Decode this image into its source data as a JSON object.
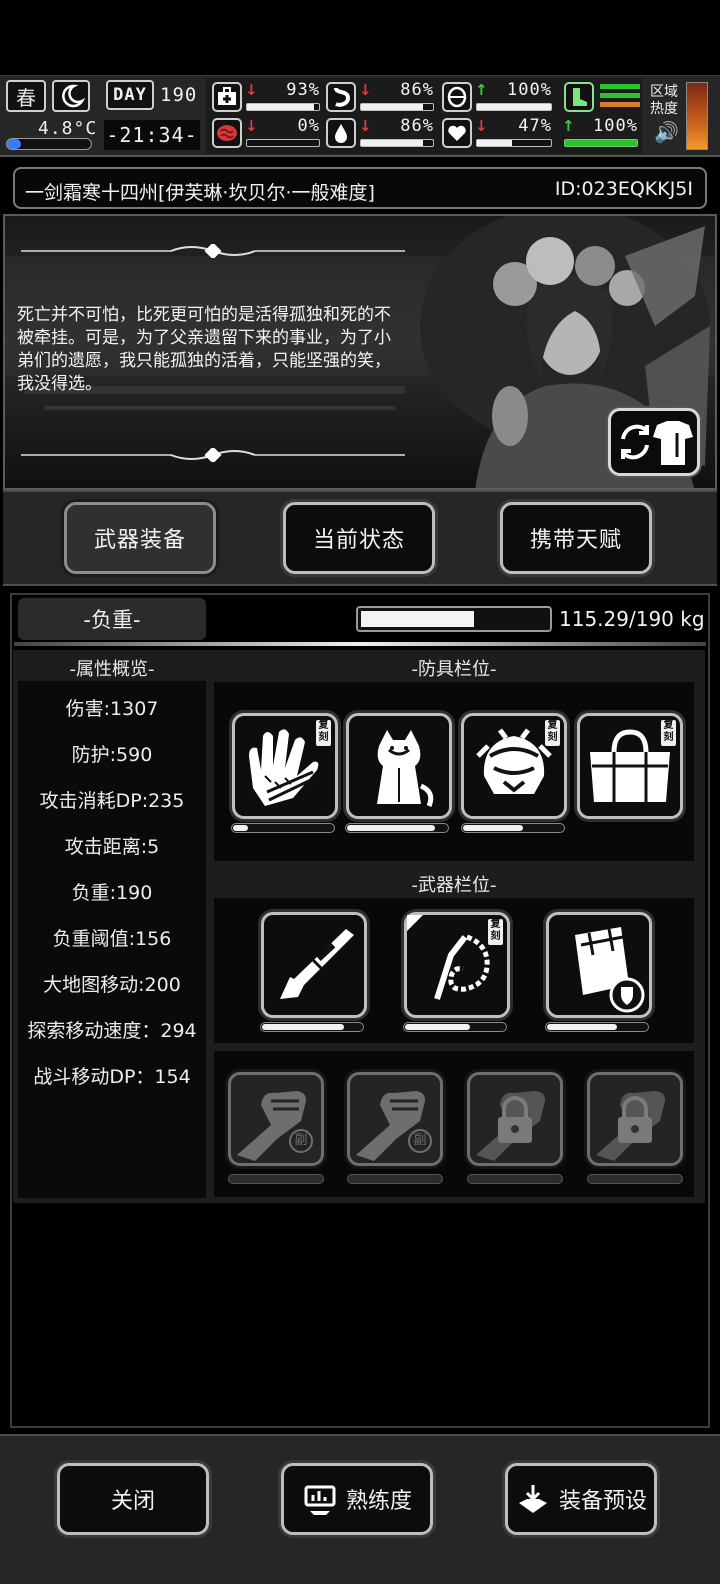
{
  "hud": {
    "season": "春",
    "temperature": "4.8°C",
    "day_label": "DAY",
    "day_value": "190",
    "clock": "-21:34-",
    "region_heat_label_1": "区域",
    "region_heat_label_2": "热度",
    "stats": [
      {
        "name": "health",
        "icon": "medkit-icon",
        "trend": "down",
        "value": "93%",
        "level": 0.93
      },
      {
        "name": "hunger",
        "icon": "stomach-icon",
        "trend": "down",
        "value": "86%",
        "level": 0.86
      },
      {
        "name": "stamina",
        "icon": "capsule-icon",
        "trend": "up",
        "value": "100%",
        "level": 1.0
      },
      {
        "name": "infection",
        "icon": "brain-icon",
        "trend": "down",
        "value": "0%",
        "level": 0.0
      },
      {
        "name": "thirst",
        "icon": "water-drop-icon",
        "trend": "down",
        "value": "86%",
        "level": 0.86
      },
      {
        "name": "mood",
        "icon": "heart-icon",
        "trend": "down",
        "value": "47%",
        "level": 0.47
      },
      {
        "name": "boots",
        "icon": "boot-icon",
        "trend": "up",
        "value": "100%",
        "level": 1.0
      }
    ]
  },
  "title": {
    "character": "一剑霜寒十四州[伊芙琳·坎贝尔·一般难度]",
    "id": "ID:023EQKKJ5I"
  },
  "portrait": {
    "quote": "死亡并不可怕，比死更可怕的是活得孤独和死的不被牵挂。可是，为了父亲遗留下来的事业，为了小弟们的遗愿，我只能孤独的活着，只能坚强的笑，我没得选。"
  },
  "tabs": [
    {
      "label": "武器装备",
      "active": true
    },
    {
      "label": "当前状态",
      "active": false
    },
    {
      "label": "携带天赋",
      "active": false
    }
  ],
  "weight": {
    "label": "-负重-",
    "text": "115.29/190 kg",
    "current": 115.29,
    "max": 190
  },
  "attributes": {
    "title": "-属性概览-",
    "items": [
      "伤害:1307",
      "防护:590",
      "攻击消耗DP:235",
      "攻击距离:5",
      "负重:190",
      "负重阈值:156",
      "大地图移动:200",
      "探索移动速度：294",
      "战斗移动DP：154"
    ]
  },
  "armor": {
    "title": "-防具栏位-",
    "slots": [
      {
        "icon": "gloves-icon",
        "badge": "复刻",
        "durability": 0.15
      },
      {
        "icon": "hooded-cloak-icon",
        "badge": "",
        "durability": 0.88
      },
      {
        "icon": "ornate-helmet-icon",
        "badge": "复刻",
        "durability": 0.6
      },
      {
        "icon": "duffel-bag-icon",
        "badge": "复刻",
        "durability": 0
      }
    ]
  },
  "weapons": {
    "title": "-武器栏位-",
    "slots": [
      {
        "icon": "shotgun-icon",
        "badge": "",
        "durability": 0.82
      },
      {
        "icon": "whip-chain-icon",
        "badge": "复刻",
        "durability": 0.65
      },
      {
        "icon": "shield-case-icon",
        "badge": "",
        "durability": 0.7
      }
    ]
  },
  "extra_slots": [
    {
      "icon": "fist-icon",
      "mark": "副",
      "locked": false
    },
    {
      "icon": "fist-icon",
      "mark": "副",
      "locked": false
    },
    {
      "icon": "padlock-icon",
      "mark": "",
      "locked": true
    },
    {
      "icon": "padlock-icon",
      "mark": "",
      "locked": true
    }
  ],
  "bottom": {
    "close": "关闭",
    "proficiency": "熟练度",
    "preset": "装备预设"
  }
}
